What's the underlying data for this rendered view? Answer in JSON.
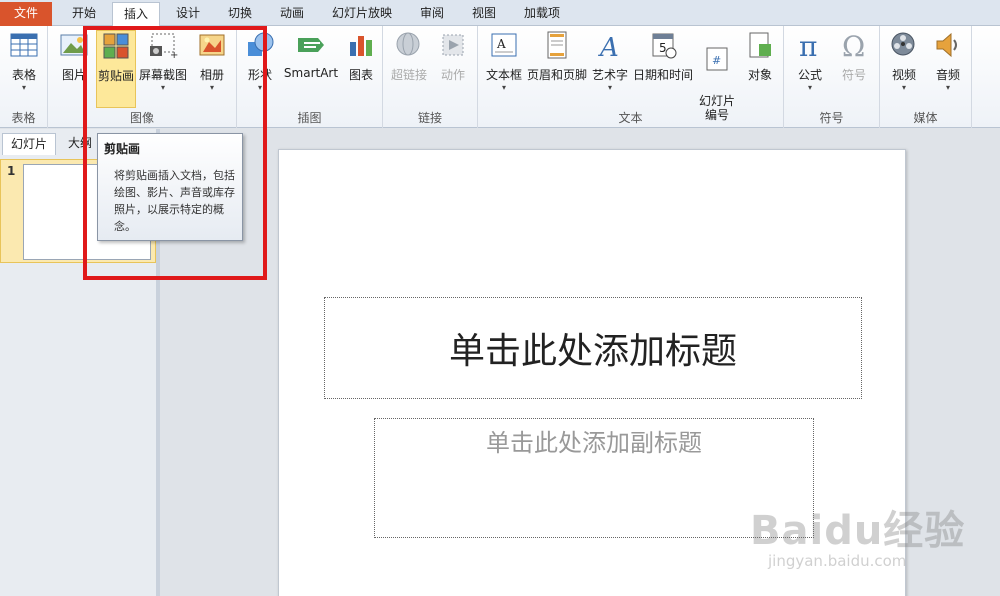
{
  "tabs": {
    "file": "文件",
    "items": [
      "开始",
      "插入",
      "设计",
      "切换",
      "动画",
      "幻灯片放映",
      "审阅",
      "视图",
      "加载项"
    ],
    "active": "插入"
  },
  "ribbon": {
    "groups": {
      "tables": "表格",
      "images": "图像",
      "illustrations": "插图",
      "links": "链接",
      "text": "文本",
      "symbols": "符号",
      "media": "媒体"
    },
    "buttons": {
      "table": "表格",
      "picture": "图片",
      "clipart": "剪贴画",
      "screenshot": "屏幕截图",
      "album": "相册",
      "shapes": "形状",
      "smartart": "SmartArt",
      "chart": "图表",
      "hyperlink": "超链接",
      "action": "动作",
      "textbox": "文本框",
      "header_footer": "页眉和页脚",
      "wordart": "艺术字",
      "datetime": "日期和时间",
      "slide_number": "幻灯片\n编号",
      "object": "对象",
      "equation": "公式",
      "symbol": "符号",
      "video": "视频",
      "audio": "音频"
    }
  },
  "tooltip": {
    "title": "剪贴画",
    "body": "将剪贴画插入文档，包括绘图、影片、声音或库存照片，以展示特定的概念。"
  },
  "left_pane": {
    "tab_slides": "幻灯片",
    "tab_outline": "大纲",
    "slide_number": "1"
  },
  "slide": {
    "title_placeholder": "单击此处添加标题",
    "subtitle_placeholder": "单击此处添加副标题"
  },
  "watermark": {
    "brand": "Baidu经验",
    "url": "jingyan.baidu.com"
  },
  "colors": {
    "file_tab": "#d9542c",
    "highlight_box": "#e0191a",
    "selected_button": "#fde89a"
  }
}
